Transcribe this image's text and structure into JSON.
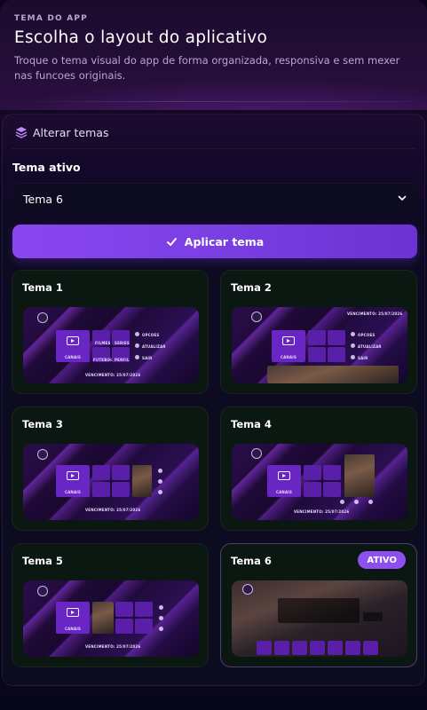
{
  "header": {
    "kicker": "TEMA DO APP",
    "title": "Escolha o layout do aplicativo",
    "subtitle": "Troque o tema visual do app de forma organizada, responsiva e sem mexer nas funcoes originais."
  },
  "panel": {
    "section_label": "Alterar temas",
    "section_icon": "layers-icon",
    "active_theme_label": "Tema ativo",
    "select": {
      "value": "Tema 6",
      "icon": "chevron-down-icon"
    },
    "apply_button": {
      "label": "Aplicar tema",
      "icon": "check-icon"
    }
  },
  "themes": [
    {
      "name": "Tema 1",
      "active": false
    },
    {
      "name": "Tema 2",
      "active": false
    },
    {
      "name": "Tema 3",
      "active": false
    },
    {
      "name": "Tema 4",
      "active": false
    },
    {
      "name": "Tema 5",
      "active": false
    },
    {
      "name": "Tema 6",
      "active": true,
      "badge": "ATIVO"
    }
  ],
  "preview_labels": {
    "canais": "CANAIS",
    "filmes": "FILMES",
    "series": "SERIES",
    "futebol": "FUTEBOL",
    "perfil": "PERFIL",
    "opcoes": "OPCOES",
    "atualizar": "ATUALIZAR",
    "sair": "SAIR",
    "vencimento": "VENCIMENTO: 25/07/2026"
  },
  "colors": {
    "accent": "#8b46f0",
    "badge": "#8c4ff0",
    "card_bg": "#0b1711",
    "tile": "#5a1fa8"
  }
}
